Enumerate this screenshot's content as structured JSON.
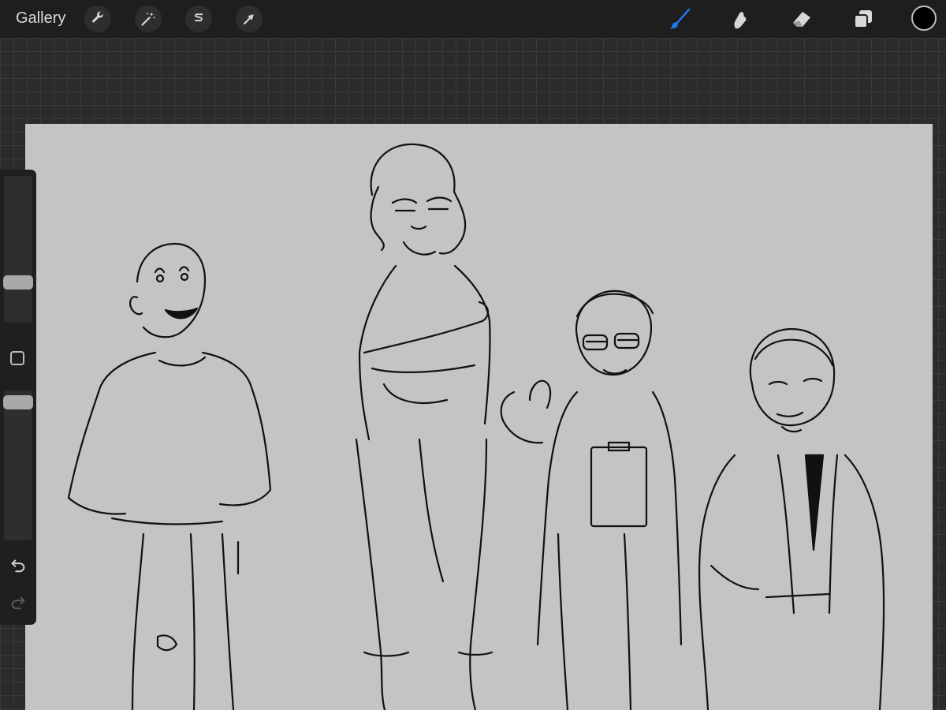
{
  "topbar": {
    "gallery_label": "Gallery",
    "left_tools": [
      {
        "icon": "wrench-icon",
        "name": "actions"
      },
      {
        "icon": "magic-wand-icon",
        "name": "adjustments"
      },
      {
        "icon": "selection-s-icon",
        "name": "selection"
      },
      {
        "icon": "arrow-cursor-icon",
        "name": "transform"
      }
    ],
    "right_tools": [
      {
        "icon": "brush-icon",
        "name": "paint",
        "active": true
      },
      {
        "icon": "smudge-icon",
        "name": "smudge"
      },
      {
        "icon": "eraser-icon",
        "name": "erase"
      },
      {
        "icon": "layers-icon",
        "name": "layers"
      }
    ],
    "current_color": "#000000",
    "active_tool_color": "#1e7cf2"
  },
  "sidebar": {
    "brush_size_level": 0.72,
    "opacity_level": 1.0,
    "icons": [
      "modify-square-icon",
      "undo-icon",
      "redo-icon"
    ]
  },
  "canvas": {
    "background_color": "#c4c3c5",
    "content": "sketch"
  }
}
